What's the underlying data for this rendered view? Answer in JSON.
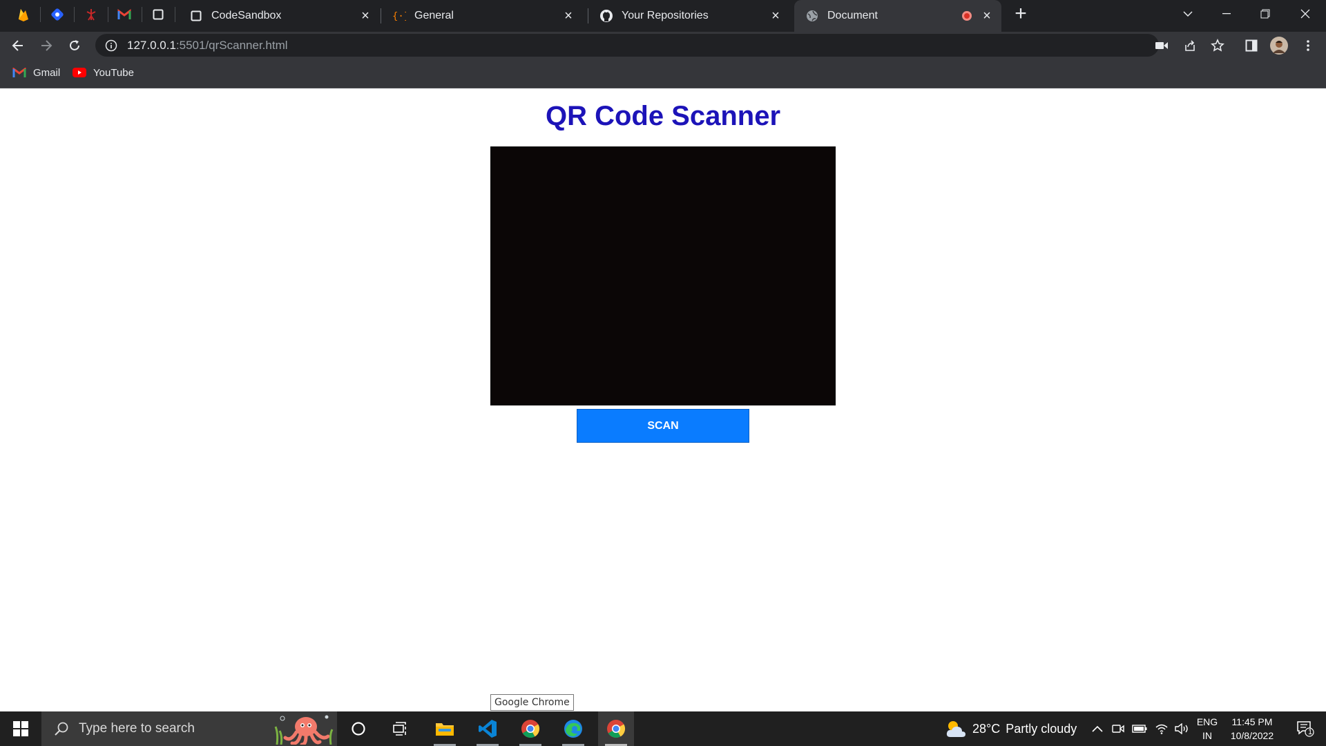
{
  "browser": {
    "tabs": [
      {
        "title": "CodeSandbox",
        "favicon": "square-icon"
      },
      {
        "title": "General",
        "favicon": "braces-icon"
      },
      {
        "title": "Your Repositories",
        "favicon": "github-icon"
      },
      {
        "title": "Document",
        "favicon": "globe-icon",
        "active": true,
        "recording": true
      }
    ],
    "url_host": "127.0.0.1",
    "url_path": ":5501/qrScanner.html",
    "bookmarks": [
      {
        "label": "Gmail",
        "icon": "gmail-icon"
      },
      {
        "label": "YouTube",
        "icon": "youtube-icon"
      }
    ]
  },
  "page": {
    "title": "QR Code Scanner",
    "scan_button": "SCAN",
    "title_color": "#1c13b8",
    "button_color": "#0a7cff"
  },
  "tooltip": "Google Chrome",
  "taskbar": {
    "search_placeholder": "Type here to search",
    "weather_temp": "28°C",
    "weather_text": "Partly cloudy",
    "language": "ENG",
    "region": "IN",
    "time": "11:45 PM",
    "date": "10/8/2022",
    "notification_count": "1"
  }
}
